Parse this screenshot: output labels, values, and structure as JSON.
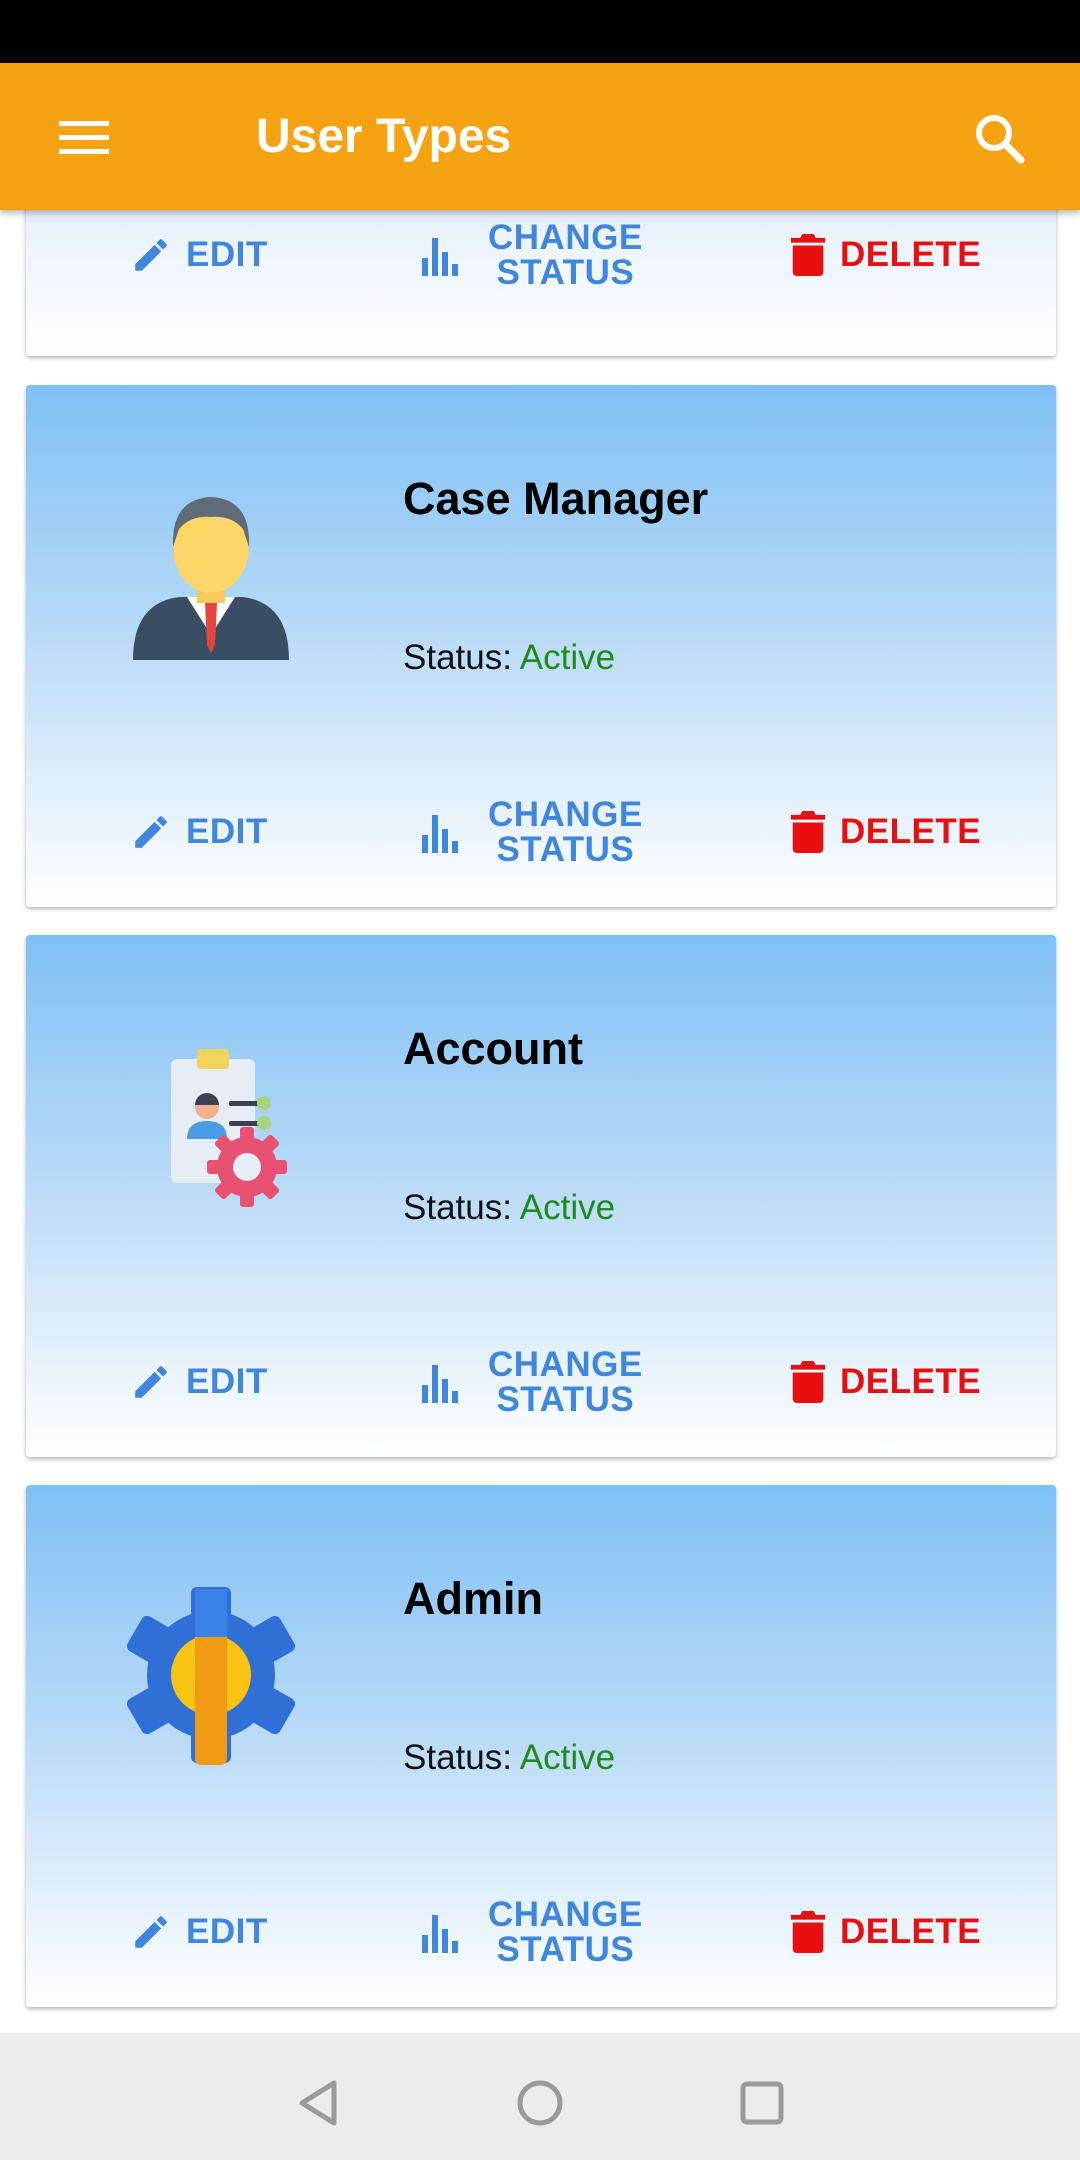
{
  "app_bar": {
    "title": "User Types",
    "menu_icon": "hamburger-menu-icon",
    "search_icon": "search-icon",
    "background": "#f6a313"
  },
  "actions": {
    "edit_label": "EDIT",
    "change_status_line1": "CHANGE",
    "change_status_line2": "STATUS",
    "delete_label": "DELETE"
  },
  "status_prefix": "Status:",
  "cards": [
    {
      "name": "Case Manager",
      "status": "Active",
      "icon": "businessman-avatar-icon"
    },
    {
      "name": "Account",
      "status": "Active",
      "icon": "clipboard-settings-icon"
    },
    {
      "name": "Admin",
      "status": "Active",
      "icon": "gear-wrench-icon"
    }
  ],
  "colors": {
    "accent_blue": "#3f86dc",
    "delete_red": "#e70f0f",
    "status_green": "#1f8b1f"
  },
  "nav_bar": {
    "back_icon": "back-triangle-icon",
    "home_icon": "home-circle-icon",
    "recents_icon": "recents-square-icon"
  }
}
